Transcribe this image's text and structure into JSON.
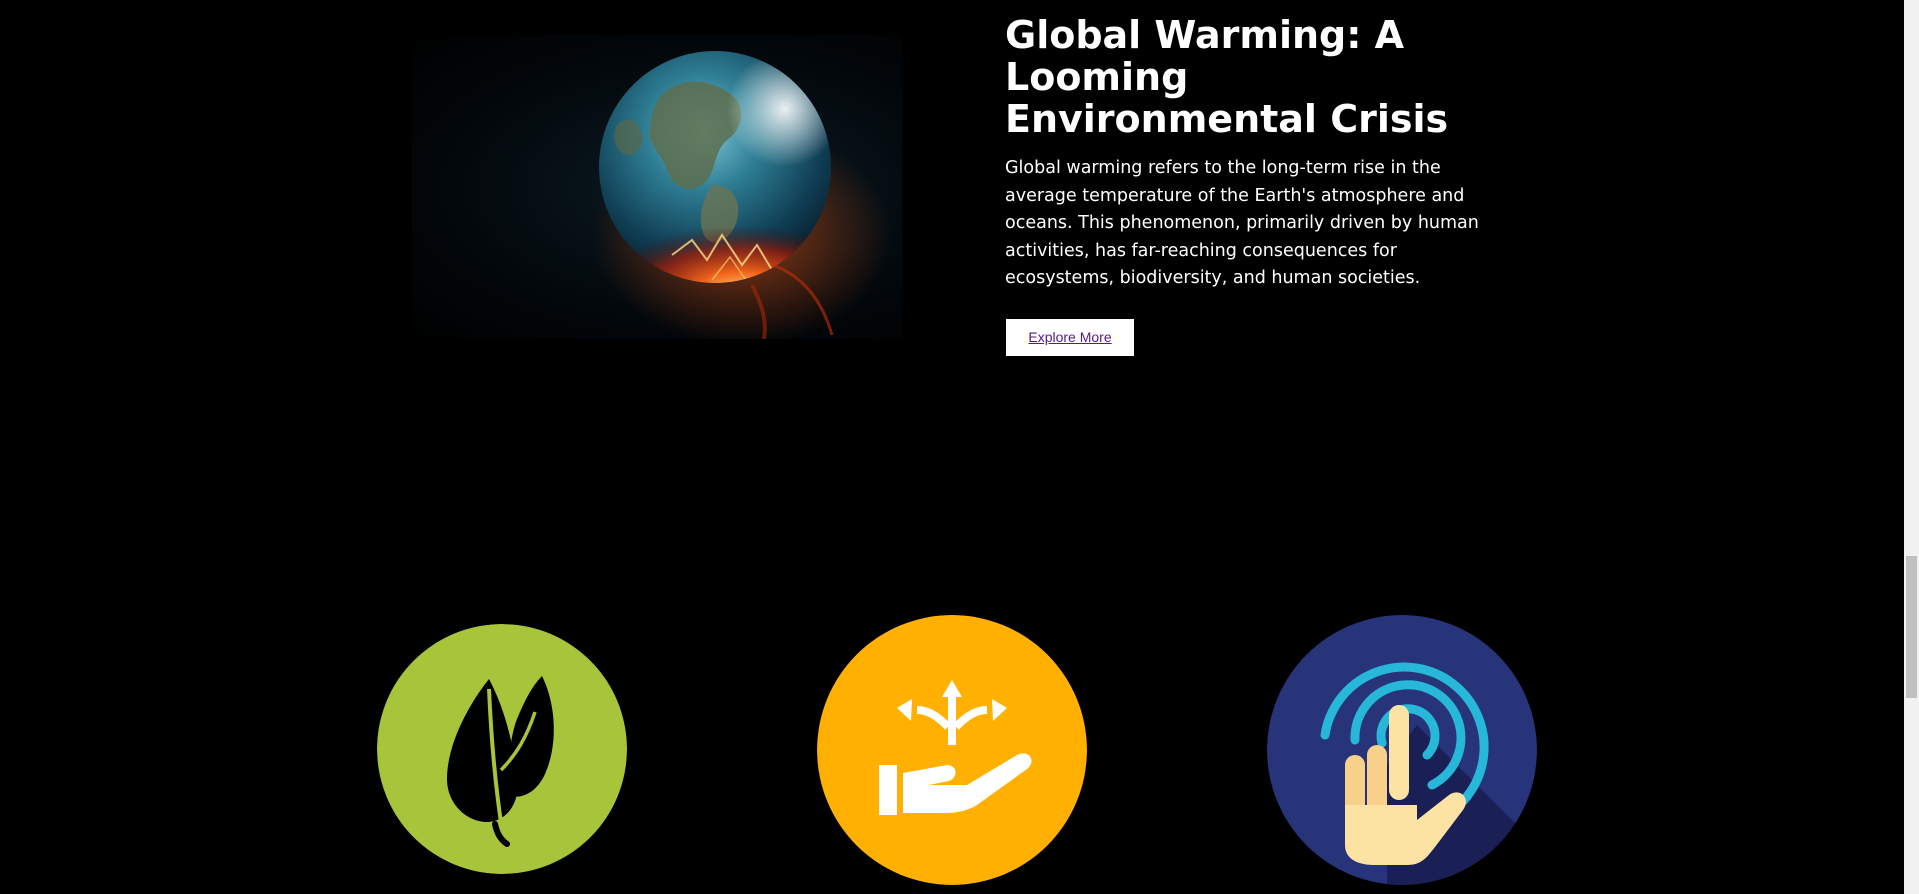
{
  "hero": {
    "image_alt": "Earth burning in space",
    "title": "Global Warming: A Looming Environmental Crisis",
    "body": "Global warming refers to the long-term rise in the average temperature of the Earth's atmosphere and oceans. This phenomenon, primarily driven by human activities, has far-reaching consequences for ecosystems, biodiversity, and human societies.",
    "button_label": "Explore More"
  },
  "features": [
    {
      "icon": "leaf-icon",
      "color": "#a8c43a"
    },
    {
      "icon": "choice-hand-icon",
      "color": "#ffb000"
    },
    {
      "icon": "touch-hand-icon",
      "color": "#27347a"
    }
  ],
  "colors": {
    "background": "#000000",
    "text": "#ffffff",
    "button_bg": "#ffffff",
    "button_text": "#551a8b"
  }
}
